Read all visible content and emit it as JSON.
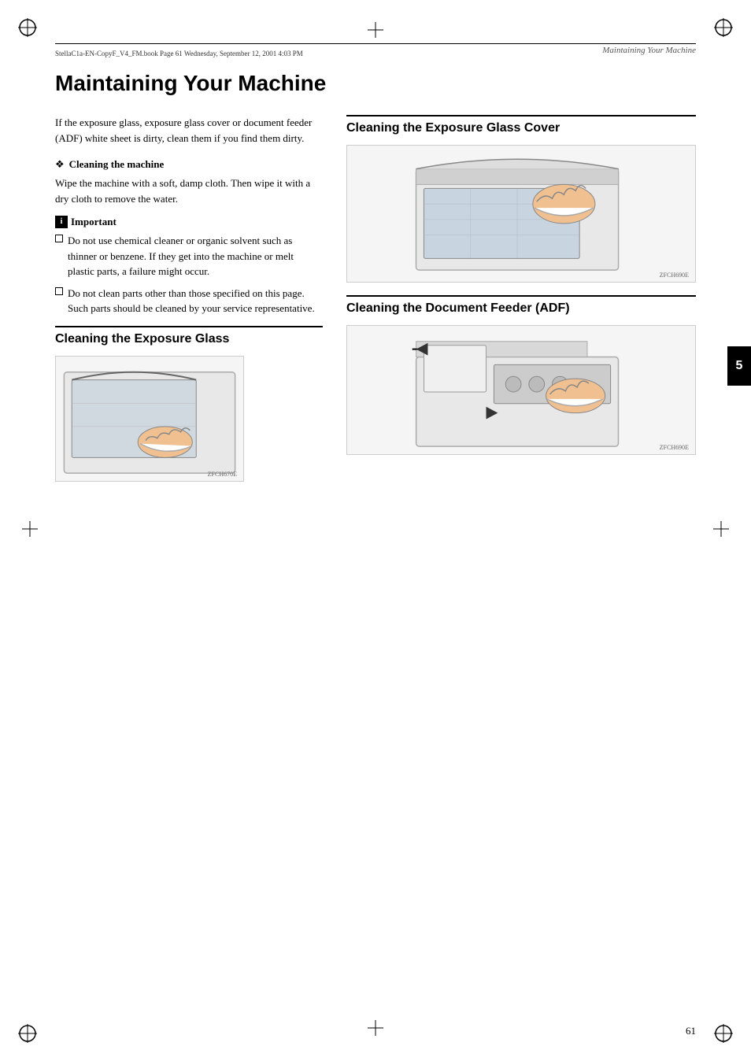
{
  "page": {
    "number": "61",
    "header": {
      "filename": "StellaC1a-EN-CopyF_V4_FM.book  Page 61  Wednesday, September 12, 2001  4:03 PM",
      "section": "Maintaining Your Machine"
    },
    "title": "Maintaining Your Machine",
    "chapter": "5",
    "intro_text": "If the exposure glass, exposure glass cover or document feeder (ADF) white sheet is dirty, clean them if you find them dirty.",
    "cleaning_machine": {
      "label": "Cleaning the machine",
      "text": "Wipe the machine with a soft, damp cloth. Then wipe it with a dry cloth to remove the water."
    },
    "important": {
      "label": "Important",
      "bullets": [
        "Do not use chemical cleaner or organic solvent such as thinner or benzene. If they get into the machine or melt plastic parts, a failure might occur.",
        "Do not clean parts other than those specified on this page. Such parts should be cleaned by your service representative."
      ]
    },
    "sections": {
      "exposure_glass": {
        "title": "Cleaning the Exposure Glass",
        "caption": "ZFCH670E"
      },
      "exposure_glass_cover": {
        "title": "Cleaning the Exposure Glass Cover",
        "caption": "ZFCH690E"
      },
      "document_feeder": {
        "title": "Cleaning the Document Feeder (ADF)",
        "caption": "ZFCH690E"
      }
    }
  }
}
